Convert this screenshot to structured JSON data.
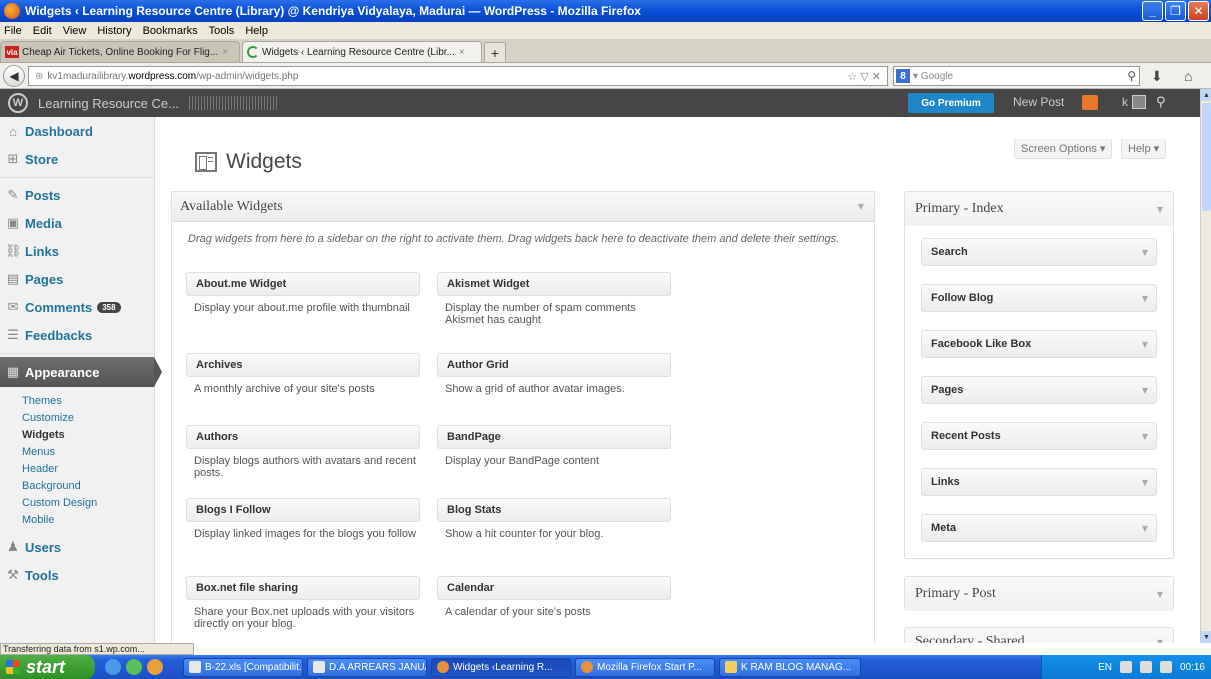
{
  "window": {
    "title": "Widgets ‹ Learning Resource Centre (Library) @ Kendriya Vidyalaya, Madurai — WordPress - Mozilla Firefox",
    "minimize": "_",
    "maximize": "❐",
    "close": "✕"
  },
  "menubar": [
    "File",
    "Edit",
    "View",
    "History",
    "Bookmarks",
    "Tools",
    "Help"
  ],
  "tabs": [
    {
      "favicon": "via",
      "label": "Cheap Air Tickets, Online Booking For Flig...",
      "close": "×"
    },
    {
      "favicon": "",
      "label": "Widgets ‹ Learning Resource Centre (Libr...",
      "close": "×"
    }
  ],
  "newtab": "+",
  "address": {
    "prefix": "kv1madurailibrary.",
    "domain": "wordpress.com",
    "path": "/wp-admin/widgets.php",
    "icons": "☆ ▽ ✕"
  },
  "search": {
    "engine": "8",
    "placeholder": "▾ Google"
  },
  "adminbar": {
    "site": "Learning Resource Ce...",
    "go_premium": "Go Premium",
    "new_post": "New Post",
    "user": "k"
  },
  "sidebar": {
    "items_top": [
      {
        "icon": "⌂",
        "label": "Dashboard"
      },
      {
        "icon": "⊞",
        "label": "Store"
      }
    ],
    "items_mid": [
      {
        "icon": "✎",
        "label": "Posts"
      },
      {
        "icon": "▣",
        "label": "Media"
      },
      {
        "icon": "⛓",
        "label": "Links"
      },
      {
        "icon": "▤",
        "label": "Pages"
      },
      {
        "icon": "✉",
        "label": "Comments",
        "badge": "358"
      },
      {
        "icon": "☰",
        "label": "Feedbacks"
      }
    ],
    "active": {
      "icon": "▦",
      "label": "Appearance"
    },
    "submenu": [
      "Themes",
      "Customize",
      "Widgets",
      "Menus",
      "Header",
      "Background",
      "Custom Design",
      "Mobile"
    ],
    "current_sub": "Widgets",
    "items_bottom": [
      {
        "icon": "♟",
        "label": "Users"
      },
      {
        "icon": "⚒",
        "label": "Tools"
      }
    ]
  },
  "page": {
    "title": "Widgets",
    "screen_options": "Screen Options ▾",
    "help": "Help ▾"
  },
  "available": {
    "title": "Available Widgets",
    "description": "Drag widgets from here to a sidebar on the right to activate them. Drag widgets back here to deactivate them and delete their settings.",
    "widgets": [
      {
        "title": "About.me Widget",
        "desc": "Display your about.me profile with thumbnail"
      },
      {
        "title": "Akismet Widget",
        "desc": "Display the number of spam comments Akismet has caught"
      },
      {
        "title": "Archives",
        "desc": "A monthly archive of your site's posts"
      },
      {
        "title": "Author Grid",
        "desc": "Show a grid of author avatar images."
      },
      {
        "title": "Authors",
        "desc": "Display blogs authors with avatars and recent posts."
      },
      {
        "title": "BandPage",
        "desc": "Display your BandPage content"
      },
      {
        "title": "Blogs I Follow",
        "desc": "Display linked images for the blogs you follow"
      },
      {
        "title": "Blog Stats",
        "desc": "Show a hit counter for your blog."
      },
      {
        "title": "Box.net file sharing",
        "desc": "Share your Box.net uploads with your visitors directly on your blog."
      },
      {
        "title": "Calendar",
        "desc": "A calendar of your site's posts"
      }
    ]
  },
  "areas": {
    "primary_index": {
      "title": "Primary - Index",
      "widgets": [
        "Search",
        "Follow Blog",
        "Facebook Like Box",
        "Pages",
        "Recent Posts",
        "Links",
        "Meta"
      ]
    },
    "primary_post": {
      "title": "Primary - Post"
    },
    "secondary_shared": {
      "title": "Secondary - Shared"
    }
  },
  "status": "Transferring data from s1.wp.com...",
  "taskbar": {
    "start": "start",
    "tasks": [
      "B-22.xls [Compatibilit...",
      "D.A ARREARS JANUA...",
      "Widgets ‹Learning R...",
      "Mozilla Firefox Start P...",
      "K RAM BLOG MANAG..."
    ],
    "lang": "EN",
    "time": "00:16"
  }
}
